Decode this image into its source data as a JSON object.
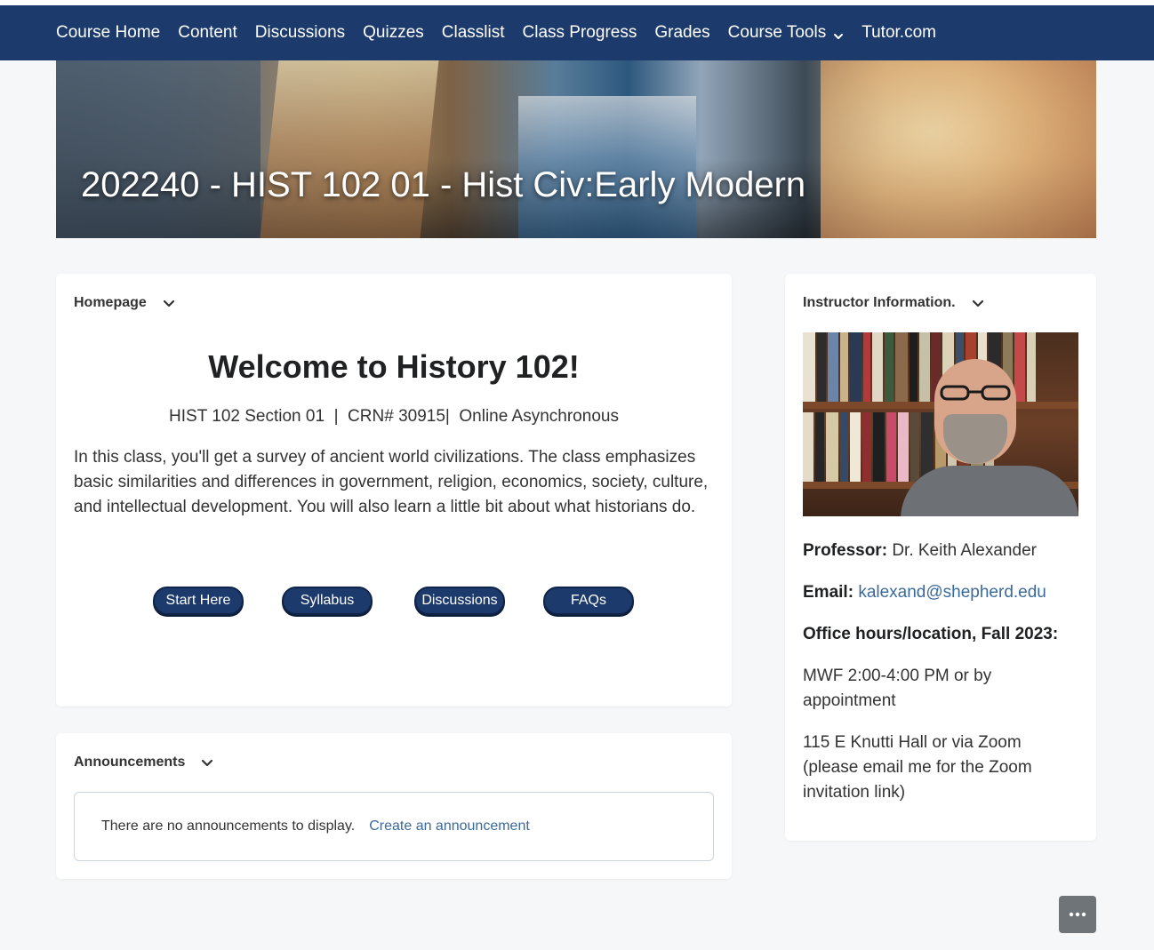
{
  "nav": {
    "items": [
      {
        "label": "Course Home"
      },
      {
        "label": "Content"
      },
      {
        "label": "Discussions"
      },
      {
        "label": "Quizzes"
      },
      {
        "label": "Classlist"
      },
      {
        "label": "Class Progress"
      },
      {
        "label": "Grades"
      },
      {
        "label": "Course Tools",
        "icon": "chevron-down-icon"
      },
      {
        "label": "Tutor.com"
      }
    ]
  },
  "banner": {
    "title": "202240 - HIST 102 01 - Hist Civ:Early Modern"
  },
  "homepage": {
    "header": "Homepage",
    "welcome": "Welcome to History 102!",
    "meta": "HIST 102 Section 01  |  CRN# 30915|  Online Asynchronous",
    "description": "In this class, you'll get a survey of ancient world civilizations. The class emphasizes basic similarities and differences in government, religion, economics, society, culture, and intellectual development. You will also learn a little bit about what historians do.",
    "buttons": {
      "start_here": "Start Here",
      "syllabus": "Syllabus",
      "discussions": "Discussions",
      "faqs": "FAQs"
    }
  },
  "announcements": {
    "header": "Announcements",
    "empty_text": "There are no announcements to display.",
    "create_link": "Create an announcement"
  },
  "instructor": {
    "header": "Instructor Information.",
    "professor_label": "Professor:",
    "professor_name": "Dr. Keith Alexander",
    "email_label": "Email:",
    "email": "kalexand@shepherd.edu",
    "office_hours_label": "Office hours/location, Fall 2023:",
    "hours": "MWF 2:00-4:00 PM or by appointment",
    "location": "115 E Knutti Hall or via Zoom (please email me for the Zoom invitation link)"
  },
  "colors": {
    "nav_bg": "#1c3a6b",
    "button_bg": "#1c3a6b",
    "link": "#3a6a9b",
    "page_bg": "#f6f7f8"
  },
  "fab": {
    "icon": "more-options-icon"
  }
}
